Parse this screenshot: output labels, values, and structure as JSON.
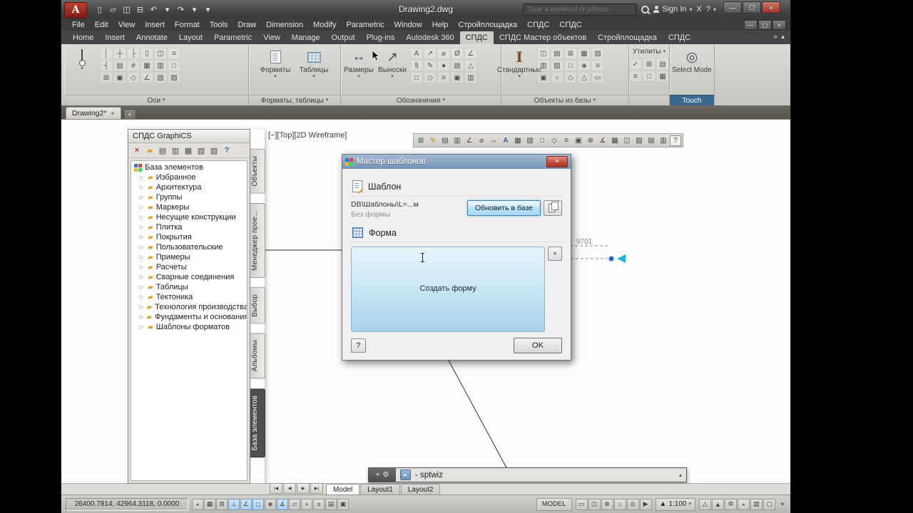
{
  "titlebar": {
    "logo_letter": "A",
    "title": "Drawing2.dwg",
    "search_placeholder": "Type a keyword or phrase",
    "sign_in_label": "Sign In",
    "exchange_label": "X",
    "help_label": "?",
    "qat": [
      {
        "name": "new-button",
        "glyph": "▯"
      },
      {
        "name": "open-button",
        "glyph": "▱"
      },
      {
        "name": "save-button",
        "glyph": "◫"
      },
      {
        "name": "plot-button",
        "glyph": "⊟"
      },
      {
        "name": "undo-button",
        "glyph": "↶"
      },
      {
        "name": "undo-dropdown",
        "glyph": "▾"
      },
      {
        "name": "redo-button",
        "glyph": "↷"
      },
      {
        "name": "redo-dropdown",
        "glyph": "▾"
      },
      {
        "name": "qat-customize-button",
        "glyph": "▾"
      }
    ]
  },
  "icons": {
    "dropdown": "▾",
    "close": "×",
    "minimize": "—",
    "restore": "▢",
    "up": "▴",
    "twisty": "▷",
    "prompt": "▸",
    "wrench": "⚙",
    "overflow": "»"
  },
  "menu_items": [
    "File",
    "Edit",
    "View",
    "Insert",
    "Format",
    "Tools",
    "Draw",
    "Dimension",
    "Modify",
    "Parametric",
    "Window",
    "Help",
    "Стройплощадка",
    "СПДС",
    "СПДС"
  ],
  "ribbon_tabs": [
    {
      "label": "Home"
    },
    {
      "label": "Insert"
    },
    {
      "label": "Annotate"
    },
    {
      "label": "Layout"
    },
    {
      "label": "Parametric"
    },
    {
      "label": "View"
    },
    {
      "label": "Manage"
    },
    {
      "label": "Output"
    },
    {
      "label": "Plug-ins"
    },
    {
      "label": "Autodesk 360"
    },
    {
      "label": "СПДС",
      "active": true
    },
    {
      "label": "СПДС Мастер объектов"
    },
    {
      "label": "Стройплощадка"
    },
    {
      "label": "СПДС"
    }
  ],
  "ribbon": {
    "panels": {
      "osi": {
        "label": "Оси"
      },
      "formats": {
        "label": "Форматы, таблицы",
        "btn1": "Форматы",
        "btn2": "Таблицы"
      },
      "symbols": {
        "label": "Обозначения",
        "btn1": "Размеры",
        "btn2": "Выноски"
      },
      "objects": {
        "label": "Объекты из базы",
        "btn1": "Стандартные"
      },
      "utils": {
        "label": "Утилиты"
      },
      "touch": {
        "label": "Touch",
        "btn1": "Select Mode"
      }
    },
    "osi_icons": [
      "│",
      "┼",
      "├",
      "▯",
      "◫",
      "≡",
      "┤",
      "▤",
      "#",
      "▦",
      "▥",
      "□",
      "⊞",
      "▣",
      "◇",
      "∠",
      "▧",
      "▨"
    ],
    "symbols_icons": [
      "A",
      "↗",
      "⌀",
      "Ø",
      "∠",
      "§",
      "✎",
      "●",
      "▤",
      "△",
      "□",
      "◇",
      "≡",
      "▣",
      "▥"
    ],
    "objects_icons": [
      "◫",
      "▤",
      "⊞",
      "▦",
      "▧",
      "▥",
      "▨",
      "□",
      "◈",
      "≡",
      "▣",
      "○",
      "◇",
      "△",
      "▭"
    ],
    "utils_icons": [
      "✓",
      "⊞",
      "▤",
      "≡",
      "□",
      "▦"
    ],
    "dim_glyph": "↔",
    "leader_glyph": "↗",
    "select_mode_glyph": "◎"
  },
  "file_tab": {
    "label": "Drawing2*"
  },
  "viewport_label": "[−][Top][2D Wireframe]",
  "drawing_toolbar": [
    "⊞",
    "✎",
    "▤",
    "▥",
    "∠",
    "⌀",
    "↔",
    "A",
    "▦",
    "▧",
    "□",
    "◇",
    "≡",
    "▣",
    "⊕",
    "∡",
    "▩",
    "◫",
    "▨",
    "▤",
    "▥",
    "?"
  ],
  "palette": {
    "title": "СПДС GraphiCS",
    "toolbar": [
      {
        "name": "palette-close-button",
        "glyph": "×",
        "cls": "red"
      },
      {
        "name": "palette-open-folder-button",
        "glyph": "▰",
        "cls": "yellow"
      },
      {
        "name": "palette-new-page-button",
        "glyph": "▤"
      },
      {
        "name": "palette-edit-button",
        "glyph": "▥"
      },
      {
        "name": "palette-copy-button",
        "glyph": "▦"
      },
      {
        "name": "palette-preview-button",
        "glyph": "▧"
      },
      {
        "name": "palette-settings-button",
        "glyph": "▨"
      },
      {
        "name": "palette-help-button",
        "glyph": "?",
        "cls": "blue"
      }
    ],
    "root_item": "База элементов",
    "tree_items": [
      "Избранное",
      "Архитектура",
      "Группы",
      "Маркеры",
      "Несущие конструкции",
      "Плитка",
      "Покрытия",
      "Пользовательские",
      "Примеры",
      "Расчеты",
      "Сварные соединения",
      "Таблицы",
      "Тектоника",
      "Технология производства",
      "Фундаменты и основания",
      "Шаблоны форматов"
    ],
    "side_tabs": [
      {
        "label": "Объекты"
      },
      {
        "label": "Менеджер прое..."
      },
      {
        "label": "Выбор"
      },
      {
        "label": "Альбомы"
      },
      {
        "label": "База элементов",
        "active": true
      }
    ]
  },
  "dialog": {
    "title": "Мастер шаблонов",
    "template_section": "Шаблон",
    "template_path": "DB\\Шаблоны\\L=...м",
    "template_note": "Без формы",
    "update_button": "Обновить в базе",
    "form_section": "Форма",
    "form_hint": "Создать форму",
    "ok_button": "OK"
  },
  "drawing": {
    "dim_text": "9701"
  },
  "command_line": {
    "text": "- sptwiz"
  },
  "layout_nav": [
    {
      "name": "first-layout-button",
      "glyph": "|◀"
    },
    {
      "name": "prev-layout-button",
      "glyph": "◀"
    },
    {
      "name": "next-layout-button",
      "glyph": "▶"
    },
    {
      "name": "last-layout-button",
      "glyph": "▶|"
    }
  ],
  "layout_tabs": [
    {
      "label": "Model",
      "active": true
    },
    {
      "label": "Layout1"
    },
    {
      "label": "Layout2"
    }
  ],
  "statusbar": {
    "coordinates": "26400.7814, 42964.3118, 0.0000",
    "toggles": [
      {
        "name": "infer-constraints-toggle",
        "glyph": "▪"
      },
      {
        "name": "snap-toggle",
        "glyph": "▦"
      },
      {
        "name": "grid-toggle",
        "glyph": "⊞"
      },
      {
        "name": "ortho-toggle",
        "glyph": "⊥",
        "active": true
      },
      {
        "name": "polar-toggle",
        "glyph": "∠",
        "active": true
      },
      {
        "name": "osnap-toggle",
        "glyph": "□",
        "active": true
      },
      {
        "name": "osnap3d-toggle",
        "glyph": "◈"
      },
      {
        "name": "otrack-toggle",
        "glyph": "∡",
        "active": true
      },
      {
        "name": "ducs-toggle",
        "glyph": "▱"
      },
      {
        "name": "dyn-toggle",
        "glyph": "+"
      },
      {
        "name": "lwt-toggle",
        "glyph": "≡"
      },
      {
        "name": "transparency-toggle",
        "glyph": "▤"
      },
      {
        "name": "quick-properties-toggle",
        "glyph": "▣"
      }
    ],
    "model_label": "MODEL",
    "right_icons": [
      {
        "name": "quick-view-layouts-button",
        "glyph": "▭"
      },
      {
        "name": "quick-view-drawings-button",
        "glyph": "◫"
      },
      {
        "name": "pan-button",
        "glyph": "⊕"
      },
      {
        "name": "zoom-button",
        "glyph": "○"
      },
      {
        "name": "steering-wheel-button",
        "glyph": "◎"
      },
      {
        "name": "showmotion-button",
        "glyph": "▶"
      }
    ],
    "scale": "1:100",
    "right_icons2": [
      {
        "name": "annotation-visibility-button",
        "glyph": "△"
      },
      {
        "name": "annotation-autoscale-button",
        "glyph": "▲"
      },
      {
        "name": "workspace-switch-button",
        "glyph": "⚙"
      },
      {
        "name": "toolbar-lock-button",
        "glyph": "▪"
      },
      {
        "name": "hardware-acceleration-button",
        "glyph": "▥"
      },
      {
        "name": "clean-screen-button",
        "glyph": "▢"
      }
    ]
  }
}
